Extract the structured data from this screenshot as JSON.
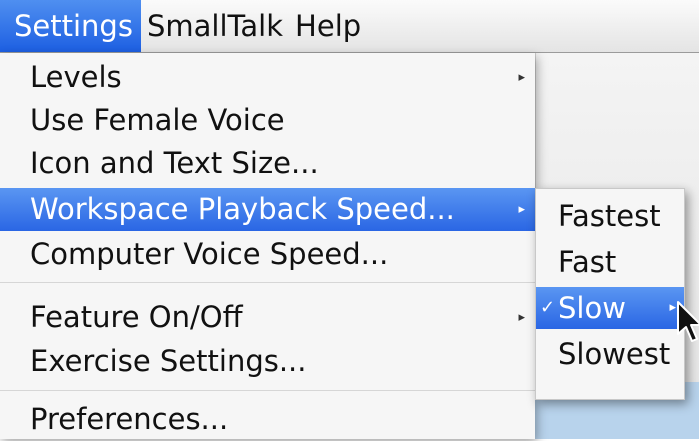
{
  "menubar": {
    "items": [
      "Settings",
      "SmallTalk",
      "Help"
    ],
    "active_index": 0
  },
  "settings_menu": {
    "items": [
      {
        "label": "Levels",
        "submenu": true
      },
      {
        "label": "Use Female Voice"
      },
      {
        "label": "Icon and Text Size..."
      },
      {
        "label": "Workspace Playback Speed...",
        "submenu": true,
        "highlighted": true
      },
      {
        "label": "Computer Voice Speed..."
      },
      {
        "label": "Feature On/Off",
        "submenu": true
      },
      {
        "label": "Exercise Settings..."
      },
      {
        "label": "Preferences..."
      }
    ]
  },
  "playback_submenu": {
    "items": [
      {
        "label": "Fastest"
      },
      {
        "label": "Fast"
      },
      {
        "label": "Slow",
        "checked": true,
        "highlighted": true
      },
      {
        "label": "Slowest"
      }
    ]
  },
  "icons": {
    "submenu_arrow": "▸",
    "checkmark": "✓",
    "cursor": "arrow-pointer-icon"
  },
  "colors": {
    "highlight": "#2a66e4",
    "menu_bg": "#f6f6f6"
  }
}
